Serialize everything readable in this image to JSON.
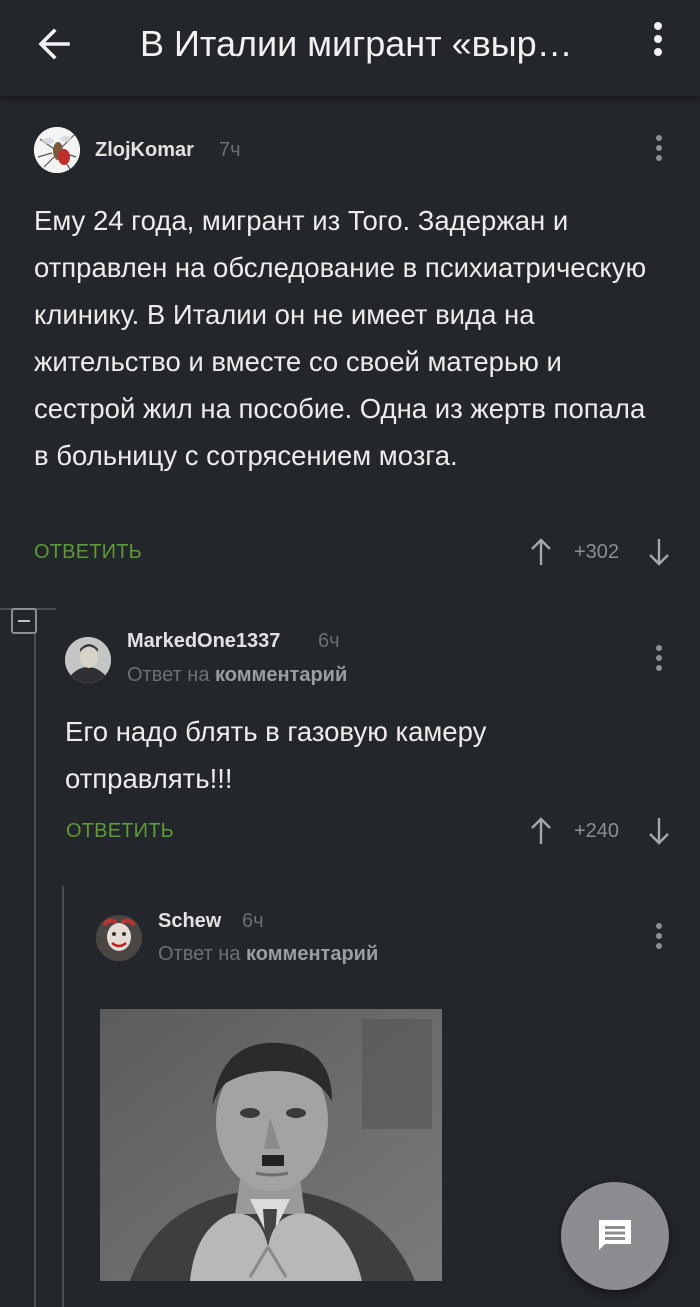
{
  "appbar": {
    "title": "В Италии мигрант «выр…"
  },
  "comments": [
    {
      "username": "ZlojKomar",
      "time": "7ч",
      "text": "Ему 24 года, мигрант из Того. Задержан и отправлен на обследование в психиатрическую клинику. В Италии он не имеет вида на жительство и вместе со своей матерью и сестрой жил на пособие. Одна из жертв попала в больницу с сотрясением мозга.",
      "reply_label": "ОТВЕТИТЬ",
      "rating": "+302"
    },
    {
      "username": "MarkedOne1337",
      "time": "6ч",
      "reply_to_prefix": "Ответ на",
      "reply_to_target": "комментарий",
      "text": "Его надо блять в газовую камеру отправлять!!!",
      "reply_label": "ОТВЕТИТЬ",
      "rating": "+240"
    },
    {
      "username": "Schew",
      "time": "6ч",
      "reply_to_prefix": "Ответ на",
      "reply_to_target": "комментарий"
    }
  ],
  "colors": {
    "background": "#23262a",
    "reply_link": "#5d9a3a",
    "fab": "#8b8d90"
  },
  "icons": [
    "back-arrow-icon",
    "more-vert-icon",
    "arrow-up-icon",
    "arrow-down-icon",
    "comment-icon",
    "collapse-icon"
  ]
}
